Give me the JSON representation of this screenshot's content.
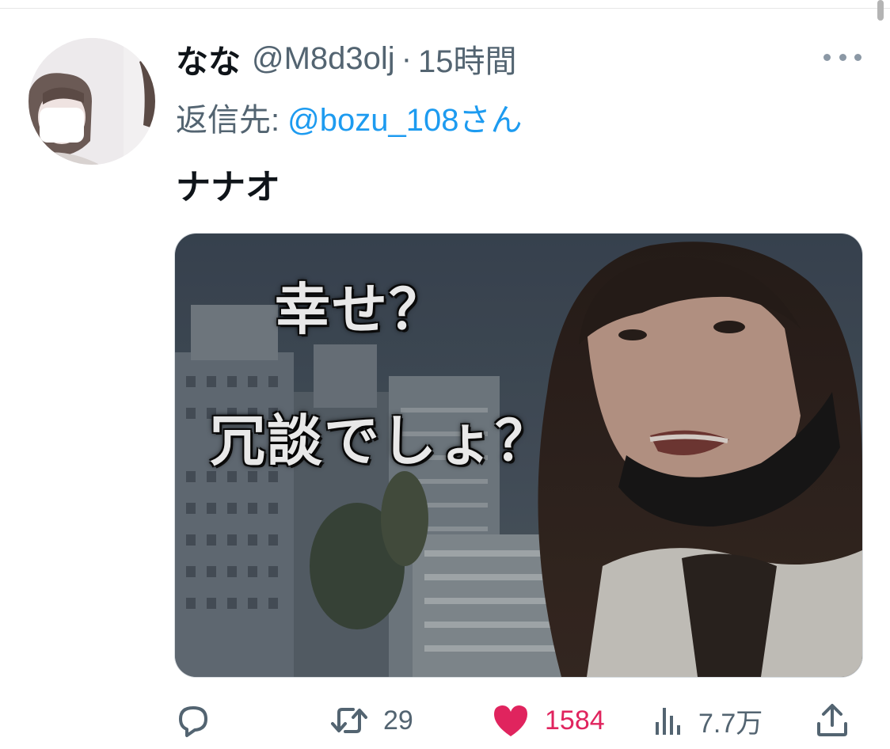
{
  "tweet": {
    "display_name": "なな",
    "handle": "@M8d3olj",
    "separator": "·",
    "time": "15時間",
    "reply_label": "返信先:",
    "reply_mention": "@bozu_108さん",
    "text": "ナナオ"
  },
  "media": {
    "overlay_line_1": "幸せ？",
    "overlay_line_2": "冗談でしょ？"
  },
  "actions": {
    "reply_icon": "comment-icon",
    "retweet_count": "29",
    "like_count": "1584",
    "views_count": "7.7万",
    "like_color": "#e0245e",
    "accent_color": "#1d9bf0"
  }
}
